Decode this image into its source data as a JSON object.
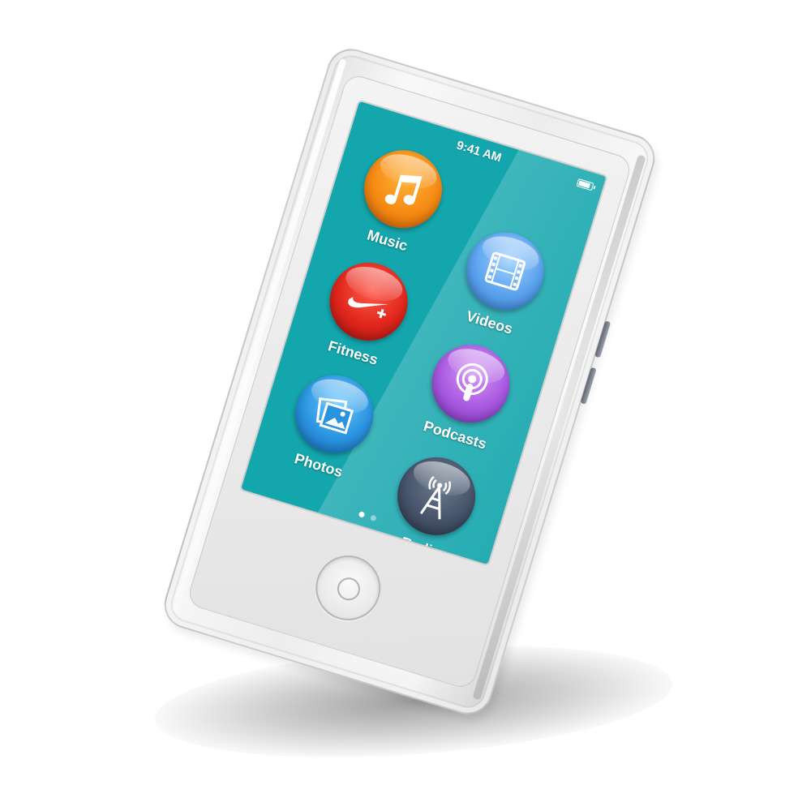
{
  "status_bar": {
    "time": "9:41 AM",
    "battery_icon": "battery-icon"
  },
  "apps": [
    {
      "label": "Music",
      "icon": "music-note-icon",
      "color": "#f58a12"
    },
    {
      "label": "Videos",
      "icon": "film-strip-icon",
      "color": "#5aa2ee"
    },
    {
      "label": "Fitness",
      "icon": "nike-swoosh-plus-icon",
      "color": "#e0261c"
    },
    {
      "label": "Podcasts",
      "icon": "podcast-icon",
      "color": "#a859e0"
    },
    {
      "label": "Photos",
      "icon": "photos-icon",
      "color": "#2a93e0"
    },
    {
      "label": "Radio",
      "icon": "radio-tower-icon",
      "color": "#46536a"
    }
  ],
  "page_indicator": {
    "pages": 2,
    "current": 1
  },
  "colors": {
    "screen_background": "#14a6ad"
  }
}
